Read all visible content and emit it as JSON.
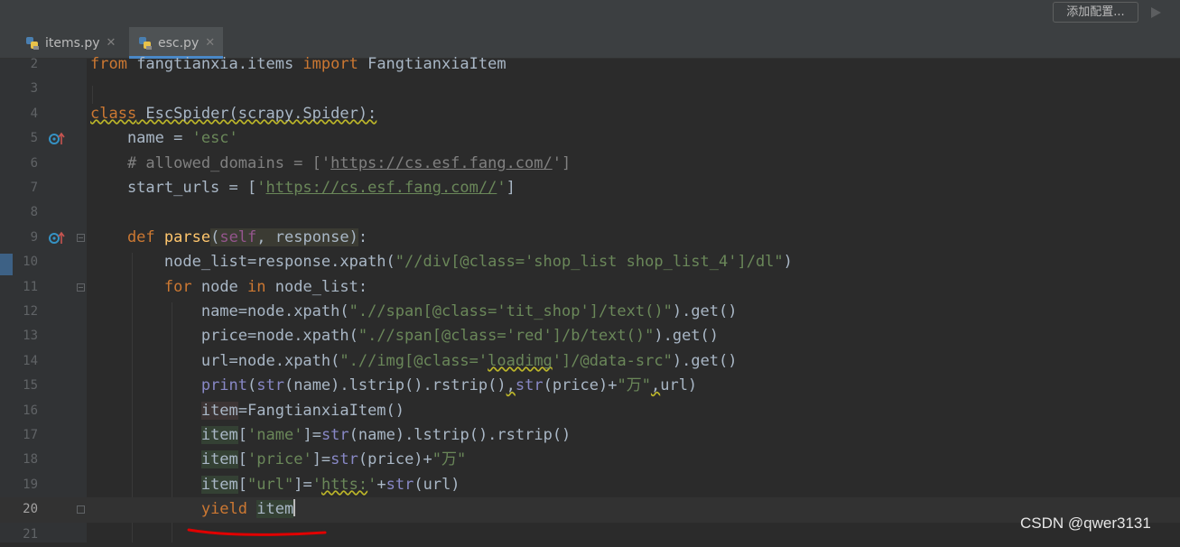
{
  "toolbar": {
    "config_label": "添加配置..."
  },
  "tabs": [
    {
      "label": "items.py",
      "close": "✕",
      "active": false
    },
    {
      "label": "esc.py",
      "close": "✕",
      "active": true
    }
  ],
  "lines": [
    {
      "n": "2"
    },
    {
      "n": "3"
    },
    {
      "n": "4"
    },
    {
      "n": "5"
    },
    {
      "n": "6"
    },
    {
      "n": "7"
    },
    {
      "n": "8"
    },
    {
      "n": "9"
    },
    {
      "n": "10"
    },
    {
      "n": "11"
    },
    {
      "n": "12"
    },
    {
      "n": "13"
    },
    {
      "n": "14"
    },
    {
      "n": "15"
    },
    {
      "n": "16"
    },
    {
      "n": "17"
    },
    {
      "n": "18"
    },
    {
      "n": "19"
    },
    {
      "n": "20"
    },
    {
      "n": "21"
    }
  ],
  "code": {
    "l2": {
      "from": "from",
      "mod": " fangtianxia.items ",
      "import": "import",
      "cls": " FangtianxiaItem"
    },
    "l4": {
      "class": "class",
      "rest": " EscSpider(scrapy.Spider):"
    },
    "l5": {
      "pre": "    name = ",
      "str": "'esc'"
    },
    "l6": {
      "comment_a": "    # allowed_domains = ['",
      "url": "https://cs.esf.fang.com/",
      "comment_b": "']"
    },
    "l7": {
      "pre": "    start_urls = [",
      "q1": "'",
      "url": "https://cs.esf.fang.com//",
      "q2": "'",
      "post": "]"
    },
    "l9": {
      "def": "    def ",
      "fn": "parse",
      "p1": "(",
      "self": "self",
      "p2": ", response",
      "p3": ")",
      "colon": ":"
    },
    "l10": {
      "pre": "        ",
      "var": "node_list",
      "mid": "=response.xpath(",
      "str": "\"//div[@class='shop_list shop_list_4']/dl\"",
      "post": ")"
    },
    "l11": {
      "pre": "        ",
      "for": "for",
      "a": " node ",
      "in": "in",
      "b": " node_list:"
    },
    "l12": {
      "pre": "            ",
      "var": "name",
      "mid": "=node.xpath(",
      "str": "\".//span[@class='tit_shop']/text()\"",
      "post": ").get()"
    },
    "l13": {
      "pre": "            ",
      "var": "price",
      "mid": "=node.xpath(",
      "str": "\".//span[@class='red']/b/text()\"",
      "post": ").get()"
    },
    "l14": {
      "pre": "            ",
      "var": "url",
      "mid": "=node.xpath(",
      "str_a": "\".//img[@class='",
      "str_b": "loadimg",
      "str_c": "']/@data-src\"",
      "post": ").get()"
    },
    "l15": {
      "pre": "            ",
      "print": "print",
      "a": "(",
      "str1": "str",
      "b": "(name).lstrip().rstrip()",
      "c1": ",",
      "str2": "str",
      "d": "(price)+",
      "wan": "\"万\"",
      "c2": ",",
      "e": "url)"
    },
    "l16": {
      "pre": "            ",
      "item": "item",
      "rest": "=FangtianxiaItem()"
    },
    "l17": {
      "pre": "            ",
      "item": "item",
      "a": "[",
      "key": "'name'",
      "b": "]=",
      "str": "str",
      "c": "(name).lstrip().rstrip()"
    },
    "l18": {
      "pre": "            ",
      "item": "item",
      "a": "[",
      "key": "'price'",
      "b": "]=",
      "str": "str",
      "c": "(price)+",
      "wan": "\"万\""
    },
    "l19": {
      "pre": "            ",
      "item": "item",
      "a": "[",
      "key": "\"url\"",
      "b": "]=",
      "q1": "'",
      "https": "htts:",
      "q2": "'",
      "c": "+",
      "str": "str",
      "d": "(url)"
    },
    "l20": {
      "pre": "            ",
      "yield": "yield",
      "sp": " ",
      "item": "item"
    }
  },
  "watermark": "CSDN @qwer3131",
  "colors": {
    "keyword": "#cc7832",
    "string": "#6a8759",
    "comment": "#808080",
    "function": "#ffc66d",
    "builtin": "#8888c6",
    "self": "#94558d",
    "text": "#a9b7c6",
    "background": "#2b2b2b",
    "annotation": "#e00000"
  },
  "icons": {
    "run": "play-icon",
    "file": "python-file-icon",
    "gutter": "override-method-icon"
  }
}
